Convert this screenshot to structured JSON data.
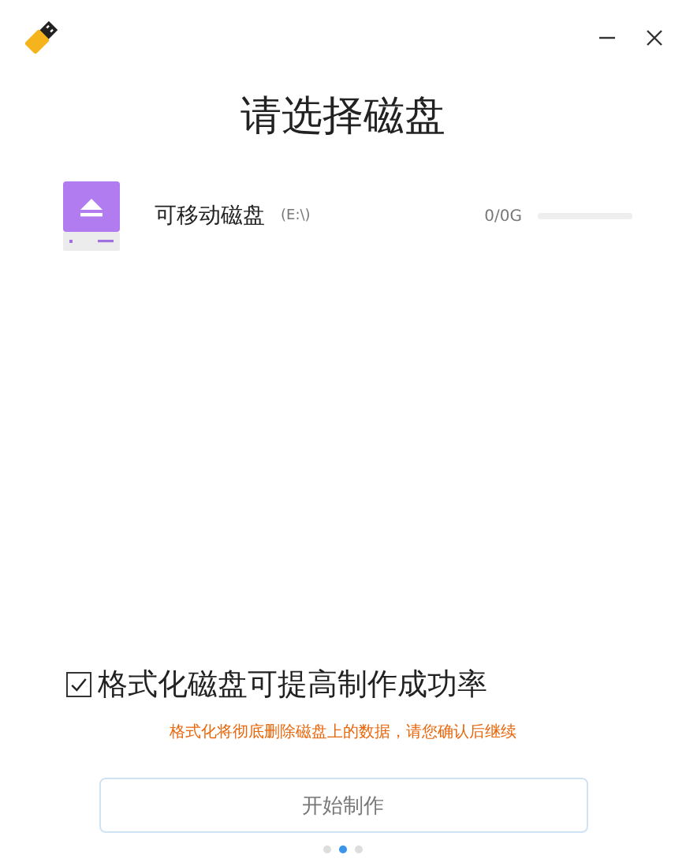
{
  "title": "请选择磁盘",
  "disks": [
    {
      "name": "可移动磁盘",
      "drive": "(E:\\)",
      "capacity": "0/0G",
      "level": 0
    }
  ],
  "format_option": {
    "label": "格式化磁盘可提高制作成功率",
    "checked": true
  },
  "warning": "格式化将彻底删除磁盘上的数据，请您确认后继续",
  "start_button": {
    "label": "开始制作"
  },
  "pages": [
    {
      "selected": false
    },
    {
      "selected": true
    },
    {
      "selected": false
    }
  ]
}
